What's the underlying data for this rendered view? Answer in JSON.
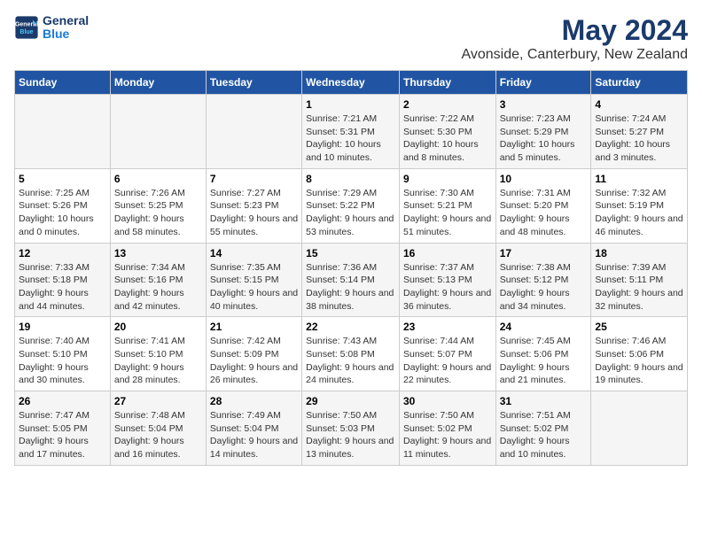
{
  "logo": {
    "line1": "General",
    "line2": "Blue"
  },
  "title": "May 2024",
  "subtitle": "Avonside, Canterbury, New Zealand",
  "days_of_week": [
    "Sunday",
    "Monday",
    "Tuesday",
    "Wednesday",
    "Thursday",
    "Friday",
    "Saturday"
  ],
  "weeks": [
    [
      {
        "day": "",
        "info": ""
      },
      {
        "day": "",
        "info": ""
      },
      {
        "day": "",
        "info": ""
      },
      {
        "day": "1",
        "info": "Sunrise: 7:21 AM\nSunset: 5:31 PM\nDaylight: 10 hours and 10 minutes."
      },
      {
        "day": "2",
        "info": "Sunrise: 7:22 AM\nSunset: 5:30 PM\nDaylight: 10 hours and 8 minutes."
      },
      {
        "day": "3",
        "info": "Sunrise: 7:23 AM\nSunset: 5:29 PM\nDaylight: 10 hours and 5 minutes."
      },
      {
        "day": "4",
        "info": "Sunrise: 7:24 AM\nSunset: 5:27 PM\nDaylight: 10 hours and 3 minutes."
      }
    ],
    [
      {
        "day": "5",
        "info": "Sunrise: 7:25 AM\nSunset: 5:26 PM\nDaylight: 10 hours and 0 minutes."
      },
      {
        "day": "6",
        "info": "Sunrise: 7:26 AM\nSunset: 5:25 PM\nDaylight: 9 hours and 58 minutes."
      },
      {
        "day": "7",
        "info": "Sunrise: 7:27 AM\nSunset: 5:23 PM\nDaylight: 9 hours and 55 minutes."
      },
      {
        "day": "8",
        "info": "Sunrise: 7:29 AM\nSunset: 5:22 PM\nDaylight: 9 hours and 53 minutes."
      },
      {
        "day": "9",
        "info": "Sunrise: 7:30 AM\nSunset: 5:21 PM\nDaylight: 9 hours and 51 minutes."
      },
      {
        "day": "10",
        "info": "Sunrise: 7:31 AM\nSunset: 5:20 PM\nDaylight: 9 hours and 48 minutes."
      },
      {
        "day": "11",
        "info": "Sunrise: 7:32 AM\nSunset: 5:19 PM\nDaylight: 9 hours and 46 minutes."
      }
    ],
    [
      {
        "day": "12",
        "info": "Sunrise: 7:33 AM\nSunset: 5:18 PM\nDaylight: 9 hours and 44 minutes."
      },
      {
        "day": "13",
        "info": "Sunrise: 7:34 AM\nSunset: 5:16 PM\nDaylight: 9 hours and 42 minutes."
      },
      {
        "day": "14",
        "info": "Sunrise: 7:35 AM\nSunset: 5:15 PM\nDaylight: 9 hours and 40 minutes."
      },
      {
        "day": "15",
        "info": "Sunrise: 7:36 AM\nSunset: 5:14 PM\nDaylight: 9 hours and 38 minutes."
      },
      {
        "day": "16",
        "info": "Sunrise: 7:37 AM\nSunset: 5:13 PM\nDaylight: 9 hours and 36 minutes."
      },
      {
        "day": "17",
        "info": "Sunrise: 7:38 AM\nSunset: 5:12 PM\nDaylight: 9 hours and 34 minutes."
      },
      {
        "day": "18",
        "info": "Sunrise: 7:39 AM\nSunset: 5:11 PM\nDaylight: 9 hours and 32 minutes."
      }
    ],
    [
      {
        "day": "19",
        "info": "Sunrise: 7:40 AM\nSunset: 5:10 PM\nDaylight: 9 hours and 30 minutes."
      },
      {
        "day": "20",
        "info": "Sunrise: 7:41 AM\nSunset: 5:10 PM\nDaylight: 9 hours and 28 minutes."
      },
      {
        "day": "21",
        "info": "Sunrise: 7:42 AM\nSunset: 5:09 PM\nDaylight: 9 hours and 26 minutes."
      },
      {
        "day": "22",
        "info": "Sunrise: 7:43 AM\nSunset: 5:08 PM\nDaylight: 9 hours and 24 minutes."
      },
      {
        "day": "23",
        "info": "Sunrise: 7:44 AM\nSunset: 5:07 PM\nDaylight: 9 hours and 22 minutes."
      },
      {
        "day": "24",
        "info": "Sunrise: 7:45 AM\nSunset: 5:06 PM\nDaylight: 9 hours and 21 minutes."
      },
      {
        "day": "25",
        "info": "Sunrise: 7:46 AM\nSunset: 5:06 PM\nDaylight: 9 hours and 19 minutes."
      }
    ],
    [
      {
        "day": "26",
        "info": "Sunrise: 7:47 AM\nSunset: 5:05 PM\nDaylight: 9 hours and 17 minutes."
      },
      {
        "day": "27",
        "info": "Sunrise: 7:48 AM\nSunset: 5:04 PM\nDaylight: 9 hours and 16 minutes."
      },
      {
        "day": "28",
        "info": "Sunrise: 7:49 AM\nSunset: 5:04 PM\nDaylight: 9 hours and 14 minutes."
      },
      {
        "day": "29",
        "info": "Sunrise: 7:50 AM\nSunset: 5:03 PM\nDaylight: 9 hours and 13 minutes."
      },
      {
        "day": "30",
        "info": "Sunrise: 7:50 AM\nSunset: 5:02 PM\nDaylight: 9 hours and 11 minutes."
      },
      {
        "day": "31",
        "info": "Sunrise: 7:51 AM\nSunset: 5:02 PM\nDaylight: 9 hours and 10 minutes."
      },
      {
        "day": "",
        "info": ""
      }
    ]
  ]
}
